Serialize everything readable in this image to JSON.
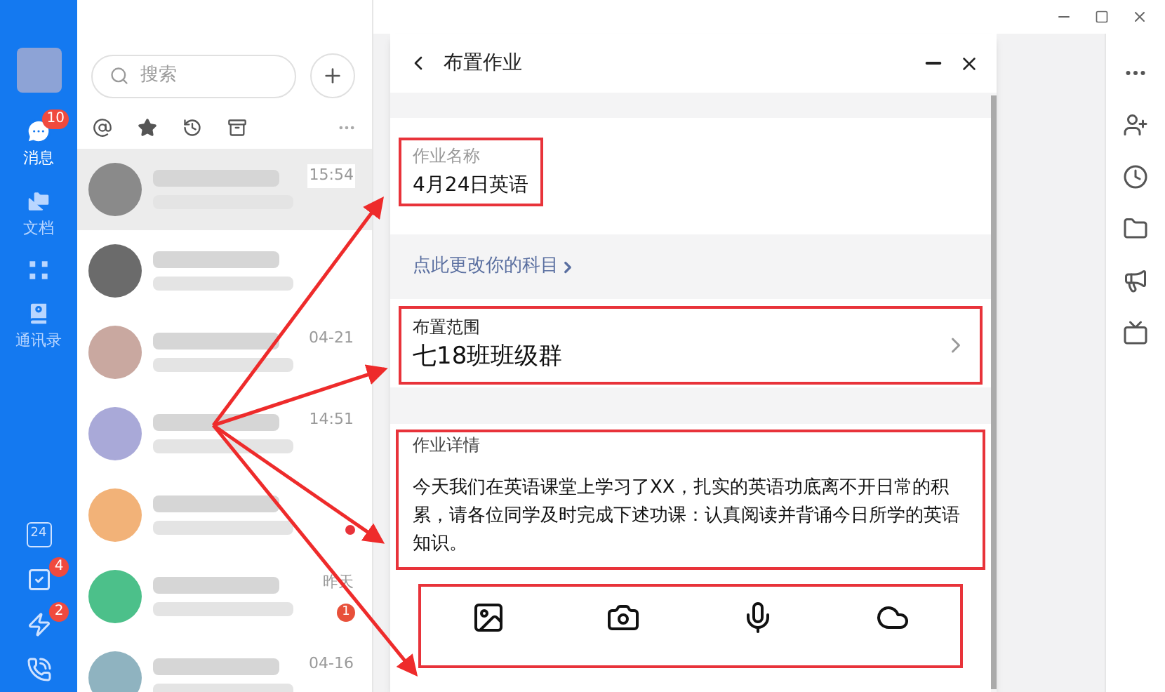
{
  "nav": {
    "items": [
      {
        "kind": "chat",
        "label": "消息",
        "badge": "10",
        "selected": true
      },
      {
        "kind": "docs",
        "label": "文档",
        "selected": false
      },
      {
        "kind": "apps",
        "selected": false
      },
      {
        "kind": "contacts",
        "label": "通讯录",
        "selected": false
      }
    ],
    "tools": [
      {
        "kind": "calendar",
        "text": "24"
      },
      {
        "kind": "todo",
        "badge": "4"
      },
      {
        "kind": "flash",
        "badge": "2"
      },
      {
        "kind": "call"
      }
    ]
  },
  "chat_list": {
    "search": {
      "placeholder": "搜索"
    },
    "filters": [
      {
        "kind": "at"
      },
      {
        "kind": "star"
      },
      {
        "kind": "recent"
      },
      {
        "kind": "archive"
      }
    ],
    "chats": [
      {
        "time": "15:54",
        "selected": true,
        "color": "#8a8a8a"
      },
      {
        "selected": false,
        "color": "#6b6b6b"
      },
      {
        "time": "04-21",
        "selected": false,
        "color": "#c9a8a0"
      },
      {
        "time": "14:51",
        "selected": false,
        "color": "#a9a9d8"
      },
      {
        "selected": false,
        "color": "#f2b278",
        "unread_dot": true
      },
      {
        "time": "昨天",
        "selected": false,
        "color": "#4cc08a",
        "badge": "1"
      },
      {
        "time": "04-16",
        "selected": false,
        "color": "#8fb3c0"
      }
    ]
  },
  "dialog": {
    "title": "布置作业",
    "name_field": {
      "label": "作业名称",
      "value": "4月24日英语",
      "highlighted": true
    },
    "subject_link": "点此更改你的科目",
    "range": {
      "label": "布置范围",
      "value": "七18班班级群",
      "highlighted": true
    },
    "details": {
      "label": "作业详情",
      "text": "今天我们在英语课堂上学习了XX，扎实的英语功底离不开日常的积累，请各位同学及时完成下述功课：认真阅读并背诵今日所学的英语知识。",
      "highlighted": true
    },
    "attachments": {
      "highlighted": true,
      "items": [
        {
          "kind": "image"
        },
        {
          "kind": "camera"
        },
        {
          "kind": "mic"
        },
        {
          "kind": "cloud"
        }
      ]
    }
  },
  "side_tools": [
    {
      "kind": "more"
    },
    {
      "kind": "add-user"
    },
    {
      "kind": "history"
    },
    {
      "kind": "folder"
    },
    {
      "kind": "megaphone"
    },
    {
      "kind": "tv"
    }
  ]
}
